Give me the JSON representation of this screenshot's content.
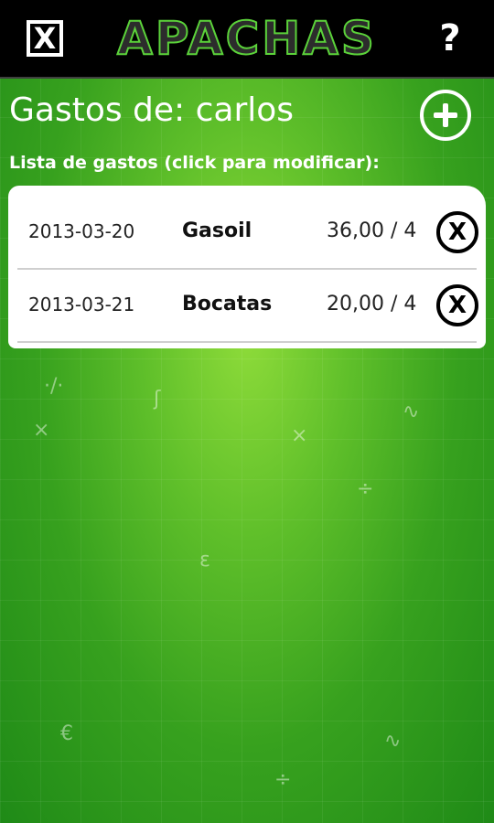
{
  "header": {
    "close_icon": "X",
    "app_title": "APACHAS",
    "help_icon": "?"
  },
  "page": {
    "title": "Gastos de: carlos",
    "subtitle": "Lista de gastos (click para modificar):",
    "add_icon": "plus-circle-icon"
  },
  "expenses": [
    {
      "date": "2013-03-20",
      "concept": "Gasoil",
      "amount": "36,00 / 4",
      "delete_icon": "X"
    },
    {
      "date": "2013-03-21",
      "concept": "Bocatas",
      "amount": "20,00 / 4",
      "delete_icon": "X"
    }
  ],
  "colors": {
    "background": "#4fb425",
    "logo_outline": "#5bd23a",
    "topbar": "#000000"
  }
}
